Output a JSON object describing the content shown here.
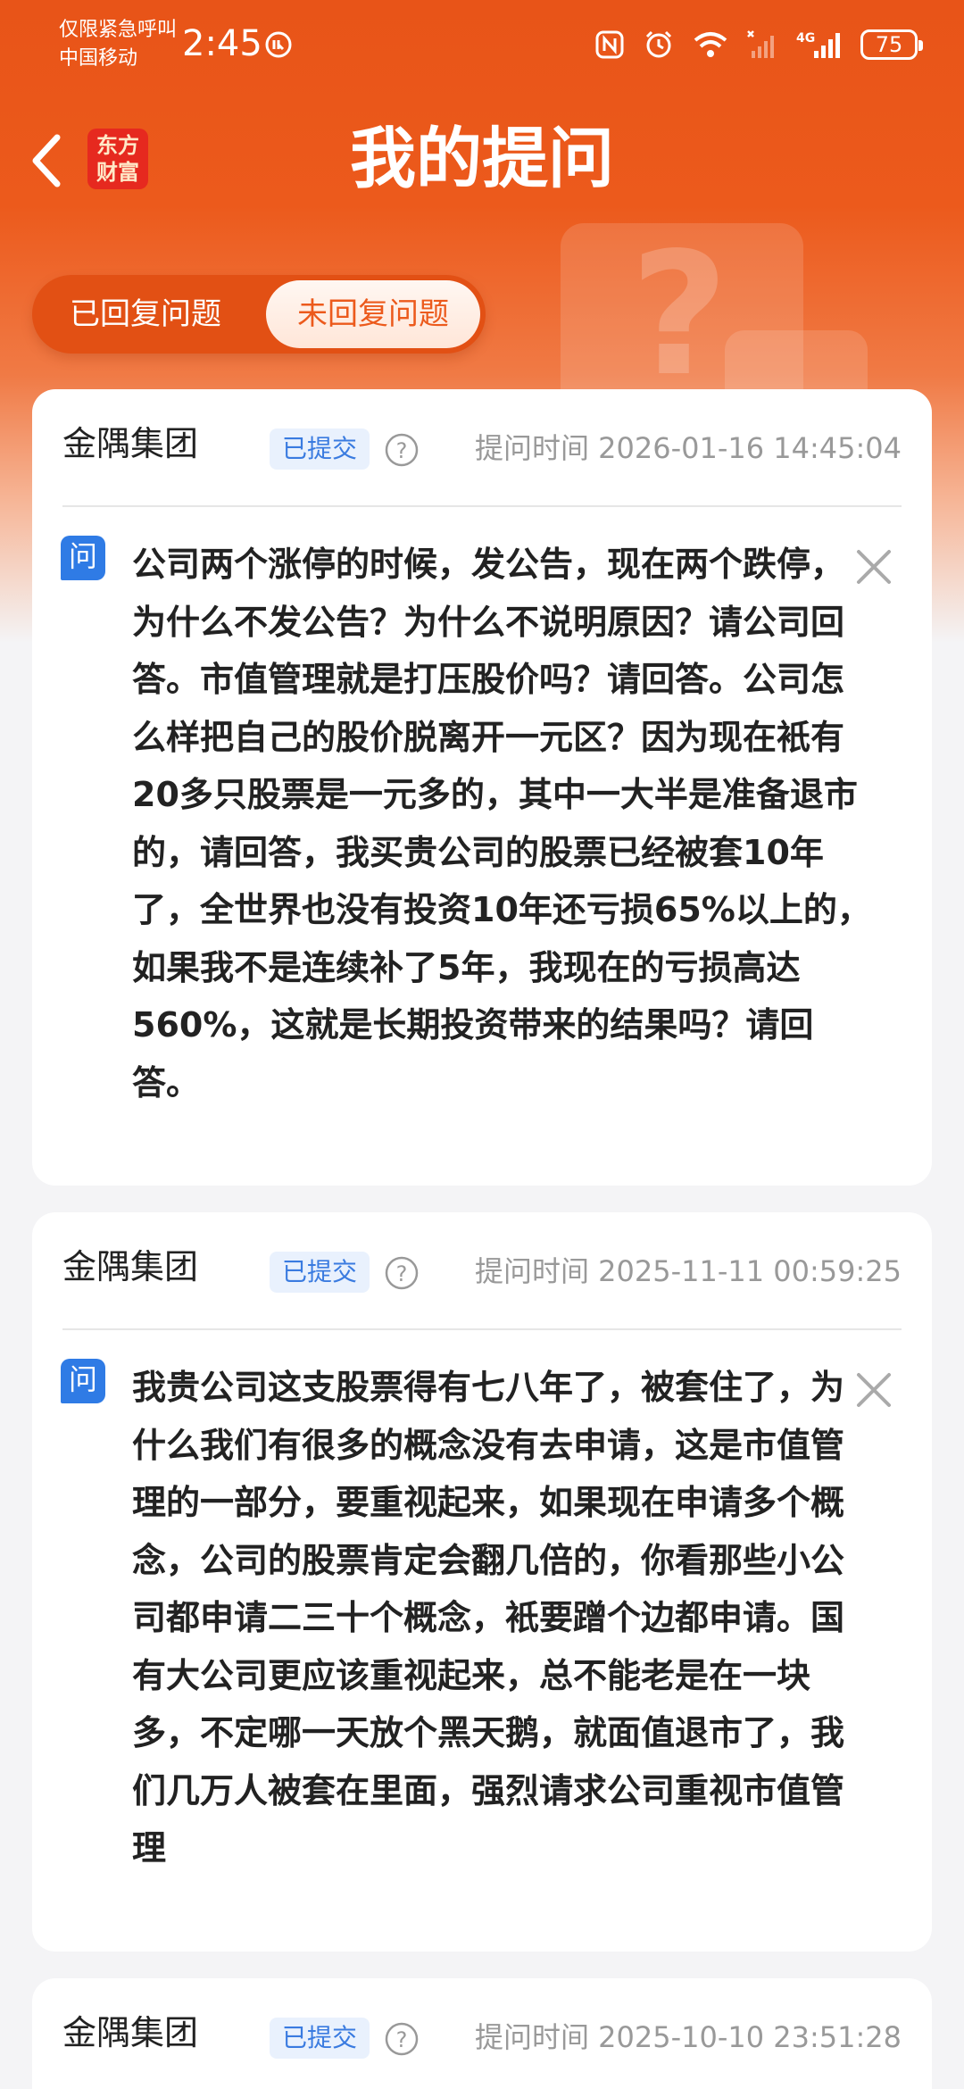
{
  "status_bar": {
    "carrier_line1": "仅限紧急呼叫",
    "carrier_line2": "中国移动",
    "time": "2:45",
    "network": "4G",
    "battery": "75"
  },
  "header": {
    "logo_line1": "东方",
    "logo_line2": "财富",
    "title": "我的提问"
  },
  "tabs": {
    "answered": "已回复问题",
    "unanswered": "未回复问题",
    "active": "unanswered"
  },
  "questions": [
    {
      "company": "金隅集团",
      "status": "已提交",
      "time": "提问时间 2026-01-16 14:45:04",
      "q_label": "问",
      "text": "公司两个涨停的时候，发公告，现在两个跌停，为什么不发公告？为什么不说明原因？请公司回答。市值管理就是打压股价吗？请回答。公司怎么样把自己的股价脱离开一元区？因为现在衹有20多只股票是一元多的，其中一大半是准备退市的，请回答，我买贵公司的股票已经被套10年了，全世界也没有投资10年还亏损65%以上的，如果我不是连续补了5年，我现在的亏损高达560%，这就是长期投资带来的结果吗？请回答。"
    },
    {
      "company": "金隅集团",
      "status": "已提交",
      "time": "提问时间 2025-11-11 00:59:25",
      "q_label": "问",
      "text": "我贵公司这支股票得有七八年了，被套住了，为什么我们有很多的概念没有去申请，这是市值管理的一部分，要重视起来，如果现在申请多个概念，公司的股票肯定会翻几倍的，你看那些小公司都申请二三十个概念，衹要蹭个边都申请。国有大公司更应该重视起来，总不能老是在一块多，不定哪一天放个黑天鹅，就面值退市了，我们几万人被套在里面，强烈请求公司重视市值管理"
    },
    {
      "company": "金隅集团",
      "status": "已提交",
      "time": "提问时间 2025-10-10 23:51:28"
    }
  ],
  "colors": {
    "brand_orange": "#ec5a1c",
    "badge_blue": "#3a7be0",
    "question_icon_blue": "#2f7be5"
  },
  "icons": [
    "back-arrow-icon",
    "nfc-icon",
    "alarm-icon",
    "wifi-icon",
    "signal-icon",
    "battery-icon",
    "help-icon",
    "close-icon",
    "question-icon"
  ]
}
